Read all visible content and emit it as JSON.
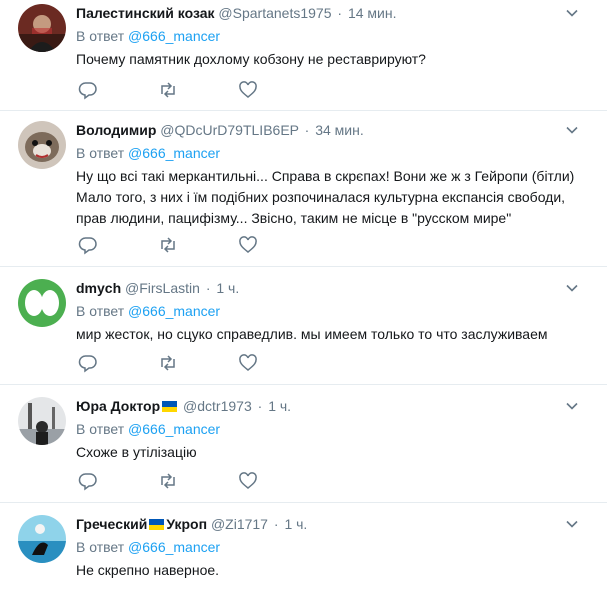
{
  "tweets": [
    {
      "name": "Палестинский козак",
      "handle": "@Spartanets1975",
      "separator": "·",
      "time": "14 мин.",
      "reply_prefix": "В ответ",
      "reply_to": "@666_mancer",
      "text": "Почему памятник дохлому кобзону не реставрируют?"
    },
    {
      "name": "Володимир",
      "handle": "@QDcUrD79TLIB6EP",
      "separator": "·",
      "time": "34 мин.",
      "reply_prefix": "В ответ",
      "reply_to": "@666_mancer",
      "text": "Ну що всі такі меркантильні... Справа в скрєпах! Вони же ж з Гейропи (бітли) Мало того, з них і їм подібних розпочиналася культурна експансія свободи, прав людини, пацифізму... Звісно, таким не місце в \"русском мире\""
    },
    {
      "name": "dmych",
      "handle": "@FirsLastin",
      "separator": "·",
      "time": "1 ч.",
      "reply_prefix": "В ответ",
      "reply_to": "@666_mancer",
      "text": "мир жесток, но сцуко справедлив. мы имеем только то что заслуживаем"
    },
    {
      "name": "Юра Доктор",
      "handle": "@dctr1973",
      "separator": "·",
      "time": "1 ч.",
      "reply_prefix": "В ответ",
      "reply_to": "@666_mancer",
      "text": "Схоже в утілізацію"
    },
    {
      "name_part1": "Гречеcкий",
      "name_part2": "Укроп",
      "handle": "@Zi1717",
      "separator": "·",
      "time": "1 ч.",
      "reply_prefix": "В ответ",
      "reply_to": "@666_mancer",
      "text": "Не скрепно наверное."
    }
  ],
  "colors": {
    "link": "#1da1f2",
    "meta": "#657786",
    "text": "#14171a",
    "divider": "#e6ecf0",
    "highlight_bg": "#f5f8fa"
  },
  "icons": [
    "reply-icon",
    "retweet-icon",
    "like-icon",
    "chevron-down-icon",
    "ukraine-flag-icon"
  ]
}
